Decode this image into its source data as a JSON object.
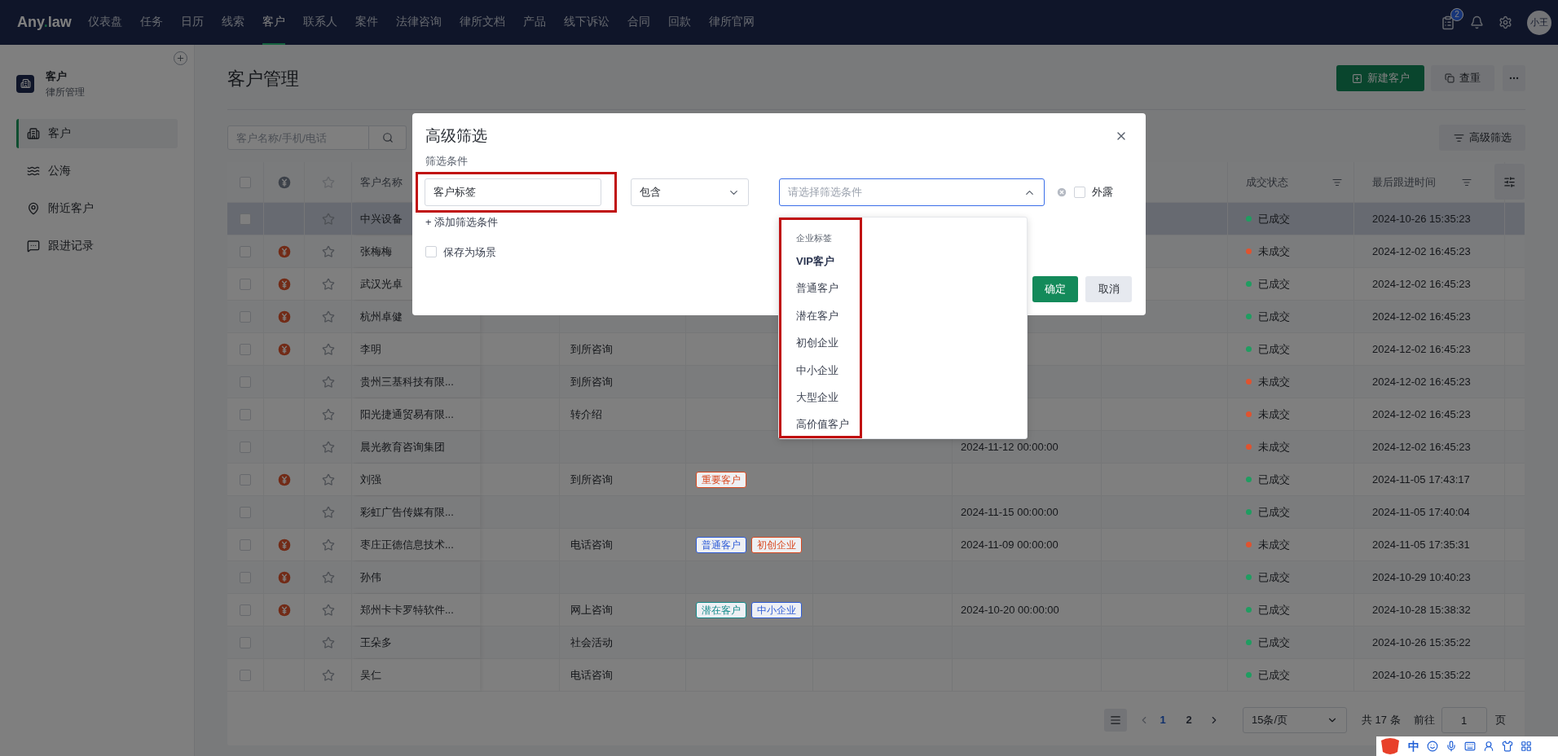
{
  "nav": {
    "logo": {
      "before": "Any",
      "accent": ".",
      "after": "law"
    },
    "items": [
      {
        "label": "仪表盘",
        "selected": false
      },
      {
        "label": "任务",
        "selected": false
      },
      {
        "label": "日历",
        "selected": false
      },
      {
        "label": "线索",
        "selected": false
      },
      {
        "label": "客户",
        "selected": true
      },
      {
        "label": "联系人",
        "selected": false
      },
      {
        "label": "案件",
        "selected": false
      },
      {
        "label": "法律咨询",
        "selected": false
      },
      {
        "label": "律所文档",
        "selected": false
      },
      {
        "label": "产品",
        "selected": false
      },
      {
        "label": "线下诉讼",
        "selected": false
      },
      {
        "label": "合同",
        "selected": false
      },
      {
        "label": "回款",
        "selected": false
      },
      {
        "label": "律所官网",
        "selected": false
      }
    ],
    "badge": "2",
    "avatar": "小王"
  },
  "sidebar": {
    "title": "客户",
    "subtitle": "律所管理",
    "items": [
      {
        "label": "客户",
        "selected": true
      },
      {
        "label": "公海",
        "selected": false
      },
      {
        "label": "附近客户",
        "selected": false
      },
      {
        "label": "跟进记录",
        "selected": false
      }
    ]
  },
  "page": {
    "title": "客户管理",
    "new_button": "新建客户",
    "dedupe_button": "查重",
    "search_placeholder": "客户名称/手机/电话",
    "advanced_button": "高级筛选"
  },
  "table": {
    "header": {
      "checked": false,
      "name": "客户名称",
      "deal_status": "成交状态",
      "last_follow": "最后跟进时间"
    },
    "rows": [
      {
        "checked": false,
        "highlighted": true,
        "deal_icon": false,
        "starred": false,
        "name": "中兴设备",
        "status": {
          "label": "已成交",
          "color": "#1f9d61"
        },
        "last_follow": "2024-10-26 15:35:23"
      },
      {
        "checked": false,
        "highlighted": false,
        "deal_icon": true,
        "starred": false,
        "name": "张梅梅",
        "status": {
          "label": "未成交",
          "color": "#e0532f"
        },
        "last_follow": "2024-12-02 16:45:23"
      },
      {
        "checked": false,
        "highlighted": false,
        "deal_icon": true,
        "starred": false,
        "name": "武汉光卓",
        "status": {
          "label": "已成交",
          "color": "#1f9d61"
        },
        "last_follow": "2024-12-02 16:45:23"
      },
      {
        "checked": false,
        "highlighted": false,
        "deal_icon": true,
        "starred": false,
        "name": "杭州卓健",
        "status": {
          "label": "已成交",
          "color": "#1f9d61"
        },
        "last_follow": "2024-12-02 16:45:23"
      },
      {
        "checked": false,
        "highlighted": false,
        "deal_icon": true,
        "starred": false,
        "name": "李明",
        "source": "到所咨询",
        "status": {
          "label": "已成交",
          "color": "#1f9d61"
        },
        "last_follow": "2024-12-02 16:45:23"
      },
      {
        "checked": false,
        "highlighted": false,
        "deal_icon": false,
        "starred": false,
        "name": "贵州三基科技有限...",
        "source": "到所咨询",
        "status": {
          "label": "未成交",
          "color": "#e0532f"
        },
        "last_follow": "2024-12-02 16:45:23"
      },
      {
        "checked": false,
        "highlighted": false,
        "deal_icon": false,
        "starred": false,
        "name": "阳光捷通贸易有限...",
        "source": "转介绍",
        "status": {
          "label": "未成交",
          "color": "#e0532f"
        },
        "last_follow": "2024-12-02 16:45:23"
      },
      {
        "checked": false,
        "highlighted": false,
        "deal_icon": false,
        "starred": false,
        "name": "晨光教育咨询集团",
        "date": "2024-11-12 00:00:00",
        "status": {
          "label": "未成交",
          "color": "#e0532f"
        },
        "last_follow": "2024-12-02 16:45:23"
      },
      {
        "checked": false,
        "highlighted": false,
        "deal_icon": true,
        "starred": false,
        "name": "刘强",
        "source": "到所咨询",
        "tags": [
          {
            "label": "重要客户",
            "color": "#d9481f"
          }
        ],
        "status": {
          "label": "已成交",
          "color": "#1f9d61"
        },
        "last_follow": "2024-11-05 17:43:17"
      },
      {
        "checked": false,
        "highlighted": false,
        "deal_icon": false,
        "starred": false,
        "name": "彩虹广告传媒有限...",
        "date": "2024-11-15 00:00:00",
        "status": {
          "label": "已成交",
          "color": "#1f9d61"
        },
        "last_follow": "2024-11-05 17:40:04"
      },
      {
        "checked": false,
        "highlighted": false,
        "deal_icon": true,
        "starred": false,
        "name": "枣庄正德信息技术...",
        "source": "电话咨询",
        "tags": [
          {
            "label": "普通客户",
            "color": "#2e5bd6"
          },
          {
            "label": "初创企业",
            "color": "#d9481f"
          }
        ],
        "date": "2024-11-09 00:00:00",
        "status": {
          "label": "未成交",
          "color": "#e0532f"
        },
        "last_follow": "2024-11-05 17:35:31"
      },
      {
        "checked": false,
        "highlighted": false,
        "deal_icon": true,
        "starred": false,
        "name": "孙伟",
        "status": {
          "label": "已成交",
          "color": "#1f9d61"
        },
        "last_follow": "2024-10-29 10:40:23"
      },
      {
        "checked": false,
        "highlighted": false,
        "deal_icon": true,
        "starred": false,
        "name": "郑州卡卡罗特软件...",
        "source": "网上咨询",
        "tags": [
          {
            "label": "潜在客户",
            "color": "#138a8a"
          },
          {
            "label": "中小企业",
            "color": "#2e5bd6"
          }
        ],
        "date": "2024-10-20 00:00:00",
        "status": {
          "label": "已成交",
          "color": "#1f9d61"
        },
        "last_follow": "2024-10-28 15:38:32"
      },
      {
        "checked": false,
        "highlighted": false,
        "deal_icon": false,
        "starred": false,
        "name": "王朵多",
        "source": "社会活动",
        "status": {
          "label": "已成交",
          "color": "#1f9d61"
        },
        "last_follow": "2024-10-26 15:35:22"
      },
      {
        "checked": false,
        "highlighted": false,
        "deal_icon": false,
        "starred": false,
        "name": "吴仁",
        "source": "电话咨询",
        "status": {
          "label": "已成交",
          "color": "#1f9d61"
        },
        "last_follow": "2024-10-26 15:35:22"
      }
    ]
  },
  "pagination": {
    "pages": [
      {
        "label": "1",
        "selected": true
      },
      {
        "label": "2",
        "selected": false
      }
    ],
    "page_size": "15条/页",
    "total": "共 17 条",
    "goto_label": "前往",
    "goto_value": "1",
    "goto_suffix": "页"
  },
  "dialog": {
    "title": "高级筛选",
    "section_label": "筛选条件",
    "field": {
      "value": "客户标签",
      "highlighted": true
    },
    "operator": "包含",
    "value_select": {
      "placeholder": "请选择筛选条件",
      "open": true
    },
    "expose": {
      "label": "外露",
      "checked": false
    },
    "add_link": "+ 添加筛选条件",
    "save_scene": {
      "label": "保存为场景",
      "checked": false
    },
    "confirm": "确定",
    "cancel": "取消",
    "dropdown": {
      "highlighted": true,
      "group": "企业标签",
      "options": [
        {
          "label": "VIP客户",
          "hovered": true
        },
        {
          "label": "普通客户",
          "hovered": false
        },
        {
          "label": "潜在客户",
          "hovered": false
        },
        {
          "label": "初创企业",
          "hovered": false
        },
        {
          "label": "中小企业",
          "hovered": false
        },
        {
          "label": "大型企业",
          "hovered": false
        },
        {
          "label": "高价值客户",
          "hovered": false
        }
      ]
    }
  },
  "ime_bar": {
    "mode": "中"
  }
}
